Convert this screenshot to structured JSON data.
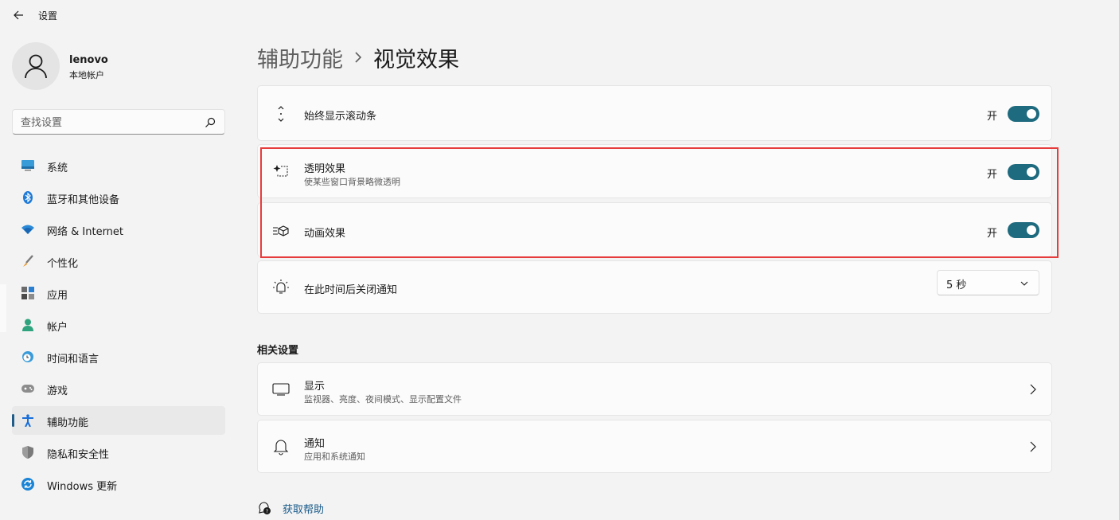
{
  "app": {
    "title": "设置"
  },
  "user": {
    "name": "lenovo",
    "type": "本地帐户"
  },
  "search": {
    "placeholder": "查找设置"
  },
  "sidebar": {
    "items": [
      {
        "label": "系统",
        "icon": "system-icon"
      },
      {
        "label": "蓝牙和其他设备",
        "icon": "bluetooth-icon"
      },
      {
        "label": "网络 & Internet",
        "icon": "wifi-icon"
      },
      {
        "label": "个性化",
        "icon": "brush-icon"
      },
      {
        "label": "应用",
        "icon": "apps-icon"
      },
      {
        "label": "帐户",
        "icon": "account-icon"
      },
      {
        "label": "时间和语言",
        "icon": "clock-globe-icon"
      },
      {
        "label": "游戏",
        "icon": "gamepad-icon"
      },
      {
        "label": "辅助功能",
        "icon": "accessibility-icon",
        "active": true
      },
      {
        "label": "隐私和安全性",
        "icon": "shield-icon"
      },
      {
        "label": "Windows 更新",
        "icon": "update-icon"
      }
    ]
  },
  "breadcrumb": {
    "parent": "辅助功能",
    "current": "视觉效果"
  },
  "settings": {
    "scrollbars": {
      "title": "始终显示滚动条",
      "state": "开",
      "on": true
    },
    "transparency": {
      "title": "透明效果",
      "subtitle": "使某些窗口背景略微透明",
      "state": "开",
      "on": true
    },
    "animation": {
      "title": "动画效果",
      "state": "开",
      "on": true
    },
    "notification": {
      "title": "在此时间后关闭通知",
      "value": "5 秒"
    }
  },
  "related": {
    "heading": "相关设置",
    "display": {
      "title": "显示",
      "subtitle": "监视器、亮度、夜间模式、显示配置文件"
    },
    "notify": {
      "title": "通知",
      "subtitle": "应用和系统通知"
    }
  },
  "help": {
    "label": "获取帮助"
  },
  "colors": {
    "accent": "#1e6a7e",
    "highlight": "#e63c3c",
    "link": "#1a5b8a"
  }
}
